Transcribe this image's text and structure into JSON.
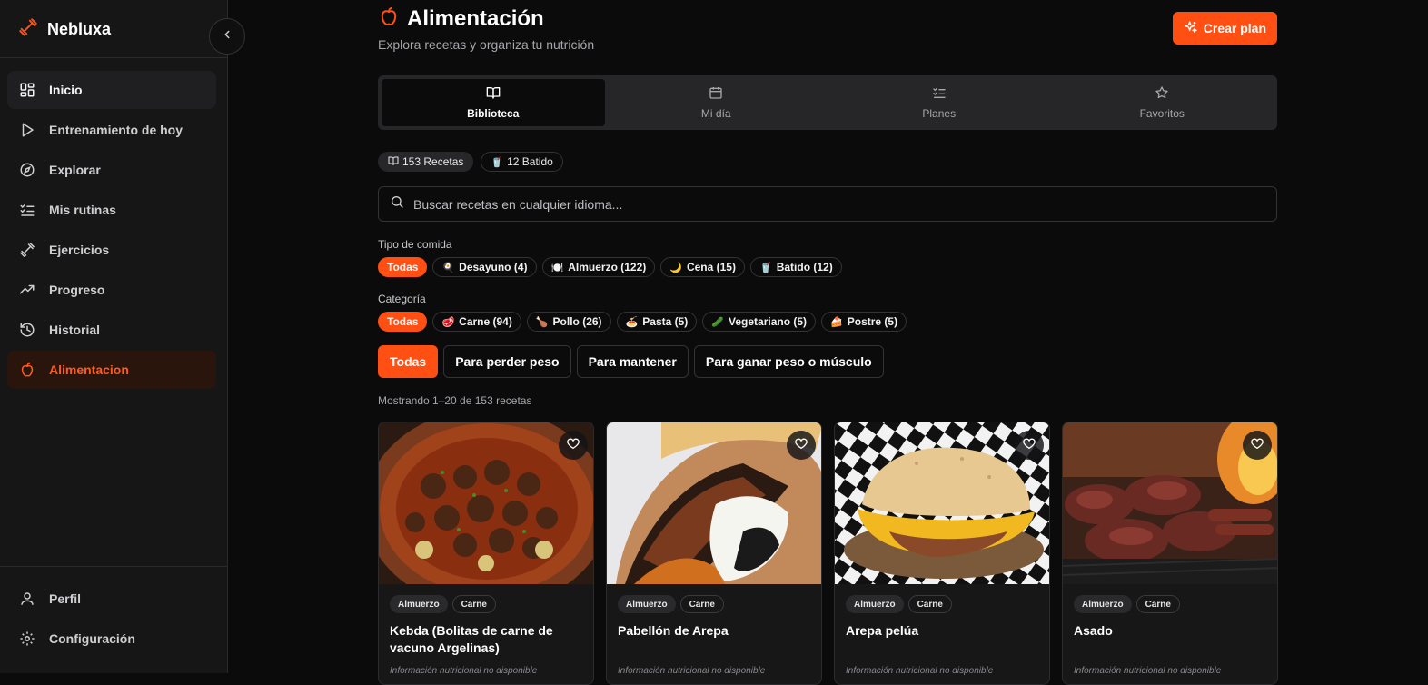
{
  "app": {
    "name": "Nebluxa",
    "accent": "#ff4f12"
  },
  "sidebar": {
    "collapse_icon": "chevron-left-icon",
    "items": [
      {
        "label": "Inicio",
        "icon": "dashboard-icon"
      },
      {
        "label": "Entrenamiento de hoy",
        "icon": "play-icon"
      },
      {
        "label": "Explorar",
        "icon": "compass-icon"
      },
      {
        "label": "Mis rutinas",
        "icon": "list-check-icon"
      },
      {
        "label": "Ejercicios",
        "icon": "dumbbell-icon"
      },
      {
        "label": "Progreso",
        "icon": "trending-up-icon"
      },
      {
        "label": "Historial",
        "icon": "history-icon"
      },
      {
        "label": "Alimentacion",
        "icon": "apple-icon"
      }
    ],
    "bottom_items": [
      {
        "label": "Perfil",
        "icon": "user-icon"
      },
      {
        "label": "Configuración",
        "icon": "gear-icon"
      }
    ]
  },
  "header": {
    "title": "Alimentación",
    "subtitle": "Explora recetas y organiza tu nutrición",
    "create_button": "Crear plan"
  },
  "tabs": [
    {
      "label": "Biblioteca",
      "icon": "book-icon"
    },
    {
      "label": "Mi día",
      "icon": "calendar-icon"
    },
    {
      "label": "Planes",
      "icon": "list-check-icon"
    },
    {
      "label": "Favoritos",
      "icon": "star-icon"
    }
  ],
  "counters": [
    {
      "label": "153 Recetas",
      "icon": "book-icon"
    },
    {
      "label": "12 Batido",
      "icon": "cup-icon"
    }
  ],
  "search": {
    "placeholder": "Buscar recetas en cualquier idioma..."
  },
  "meal_type": {
    "label": "Tipo de comida",
    "chips": [
      {
        "label": "Todas",
        "emoji": ""
      },
      {
        "label": "Desayuno (4)",
        "emoji": "🍳"
      },
      {
        "label": "Almuerzo (122)",
        "emoji": "🍽️"
      },
      {
        "label": "Cena (15)",
        "emoji": "🌙"
      },
      {
        "label": "Batido (12)",
        "emoji": "🥤"
      }
    ]
  },
  "category": {
    "label": "Categoría",
    "chips": [
      {
        "label": "Todas",
        "emoji": ""
      },
      {
        "label": "Carne (94)",
        "emoji": "🥩"
      },
      {
        "label": "Pollo (26)",
        "emoji": "🍗"
      },
      {
        "label": "Pasta (5)",
        "emoji": "🍝"
      },
      {
        "label": "Vegetariano (5)",
        "emoji": "🥒"
      },
      {
        "label": "Postre (5)",
        "emoji": "🍰"
      }
    ]
  },
  "goals": [
    "Todas",
    "Para perder peso",
    "Para mantener",
    "Para ganar peso o músculo"
  ],
  "results": {
    "showing": "Mostrando 1–20 de 153 recetas"
  },
  "cards": [
    {
      "title": "Kebda (Bolitas de carne de vacuno Argelinas)",
      "tags": [
        "Almuerzo",
        "Carne"
      ],
      "note": "Información nutricional no disponible"
    },
    {
      "title": "Pabellón de Arepa",
      "tags": [
        "Almuerzo",
        "Carne"
      ],
      "note": "Información nutricional no disponible"
    },
    {
      "title": "Arepa pelúa",
      "tags": [
        "Almuerzo",
        "Carne"
      ],
      "note": "Información nutricional no disponible"
    },
    {
      "title": "Asado",
      "tags": [
        "Almuerzo",
        "Carne"
      ],
      "note": "Información nutricional no disponible"
    }
  ]
}
